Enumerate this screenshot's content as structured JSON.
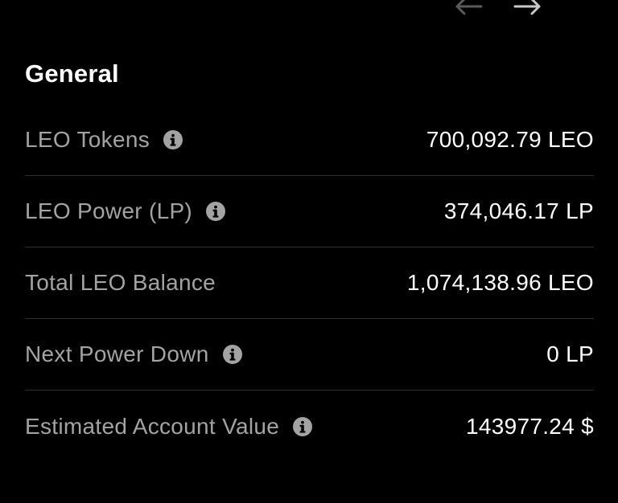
{
  "navigation": {
    "prev_icon": "arrow-left-icon",
    "next_icon": "arrow-right-icon"
  },
  "section": {
    "title": "General"
  },
  "rows": [
    {
      "label": "LEO Tokens",
      "value": "700,092.79 LEO",
      "has_info": true
    },
    {
      "label": "LEO Power (LP)",
      "value": "374,046.17 LP",
      "has_info": true
    },
    {
      "label": "Total LEO Balance",
      "value": "1,074,138.96 LEO",
      "has_info": false
    },
    {
      "label": "Next Power Down",
      "value": "0 LP",
      "has_info": true
    },
    {
      "label": "Estimated Account Value",
      "value": "143977.24 $",
      "has_info": true
    }
  ],
  "colors": {
    "background": "#000000",
    "title": "#ffffff",
    "label": "#a3a3a3",
    "value": "#ffffff",
    "divider": "#2e2e2e",
    "info_icon": "#a3a3a3",
    "arrow_prev": "#5a5a5a",
    "arrow_next": "#c8c8c8"
  }
}
